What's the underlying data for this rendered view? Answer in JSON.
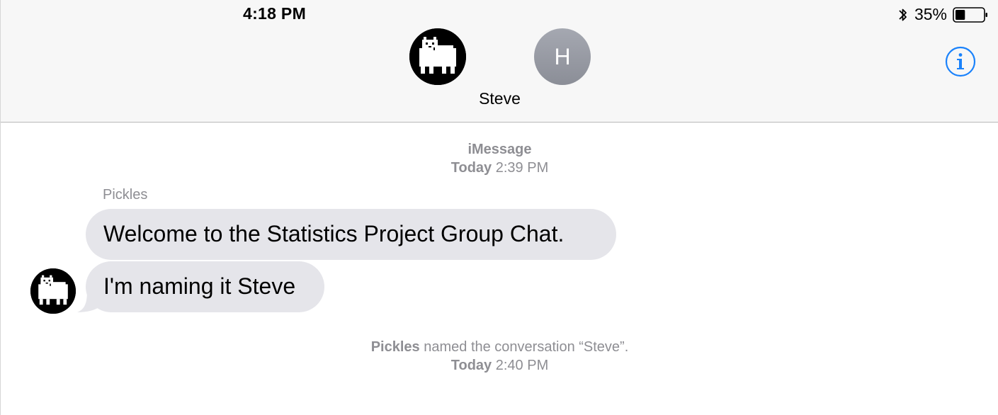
{
  "status_bar": {
    "time": "4:18 PM",
    "battery_percent": "35%",
    "battery_level": 0.35,
    "bluetooth_icon": "bluetooth-icon",
    "battery_icon": "battery-icon"
  },
  "header": {
    "participants": [
      {
        "type": "image",
        "icon": "pixel-dog-avatar"
      },
      {
        "type": "initial",
        "initial": "H"
      }
    ],
    "conversation_name": "Steve",
    "info_icon": "info-circle-icon",
    "accent_color": "#1a82fb"
  },
  "transcript": {
    "service": "iMessage",
    "first_timestamp": {
      "day": "Today",
      "time": "2:39 PM"
    },
    "sender_name": "Pickles",
    "messages": [
      {
        "text": "Welcome to the Statistics Project Group Chat."
      },
      {
        "text": "I'm naming it Steve"
      }
    ],
    "rename_notice": {
      "actor": "Pickles",
      "action": " named the conversation “Steve”.",
      "day": "Today",
      "time": "2:40 PM"
    },
    "bubble_color": "#e5e5ea",
    "meta_text_color": "#8e8e93"
  }
}
